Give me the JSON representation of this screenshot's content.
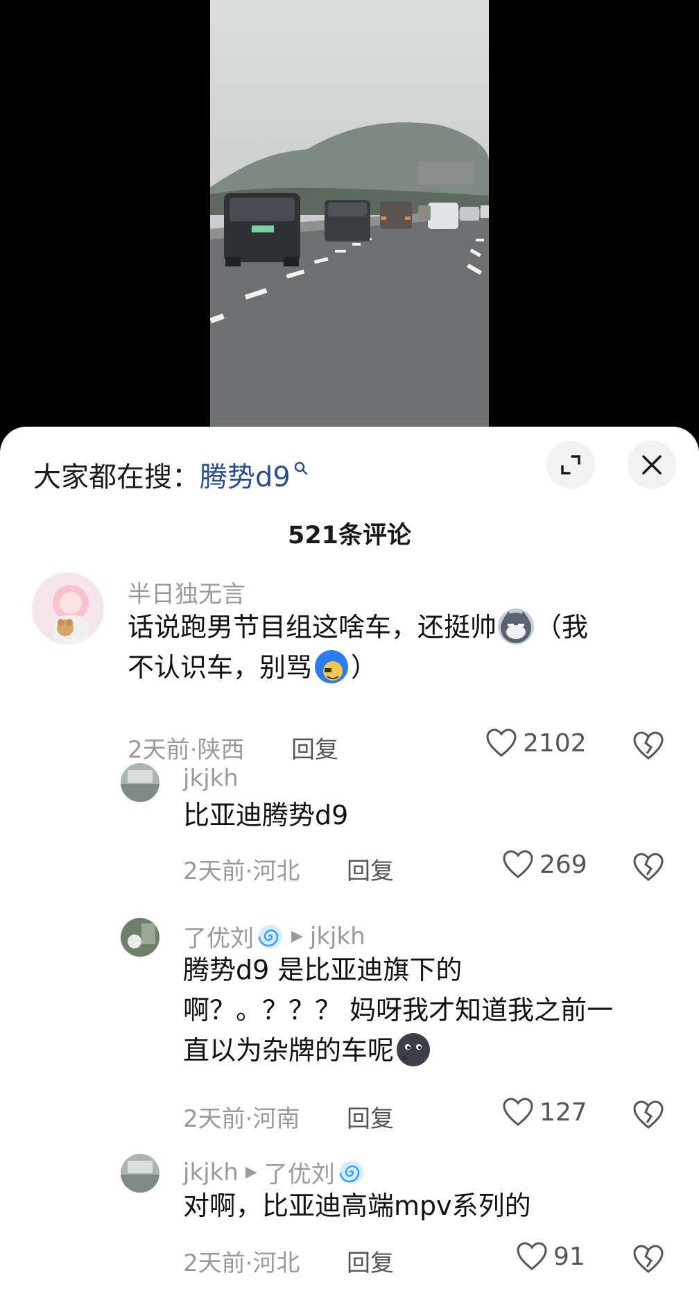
{
  "header": {
    "search_prefix": "大家都在搜：",
    "search_keyword": "腾势d9",
    "comment_count": "521条评论"
  },
  "comments": [
    {
      "user": "半日独无言",
      "text_line1": "话说跑男节目组这啥车，还挺帅",
      "text_line1b": "（我",
      "text_line2": "不认识车，别骂",
      "text_line2b": "）",
      "time_location": "2天前·陕西",
      "reply_label": "回复",
      "likes": "2102"
    },
    {
      "user": "jkjkh",
      "text_line1": "比亚迪腾势d9",
      "time_location": "2天前·河北",
      "reply_label": "回复",
      "likes": "269"
    },
    {
      "user": "了优刘",
      "reply_to": "jkjkh",
      "text_line1": "腾势d9 是比亚迪旗下的",
      "text_line2": "啊？。？？？ 妈呀我才知道我之前一",
      "text_line3": "直以为杂牌的车呢",
      "time_location": "2天前·河南",
      "reply_label": "回复",
      "likes": "127"
    },
    {
      "user": "jkjkh",
      "reply_to": "了优刘",
      "text_line1": "对啊，比亚迪高端mpv系列的",
      "time_location": "2天前·河北",
      "reply_label": "回复",
      "likes": "91"
    }
  ],
  "icons": [
    "search-mini-icon",
    "expand-icon",
    "close-icon",
    "heart-icon",
    "broken-heart-icon",
    "arrow-right-icon",
    "spiral-icon"
  ],
  "colors": {
    "keyword": "#2a4d8c",
    "meta": "#9a9a9a",
    "text": "#111111"
  }
}
